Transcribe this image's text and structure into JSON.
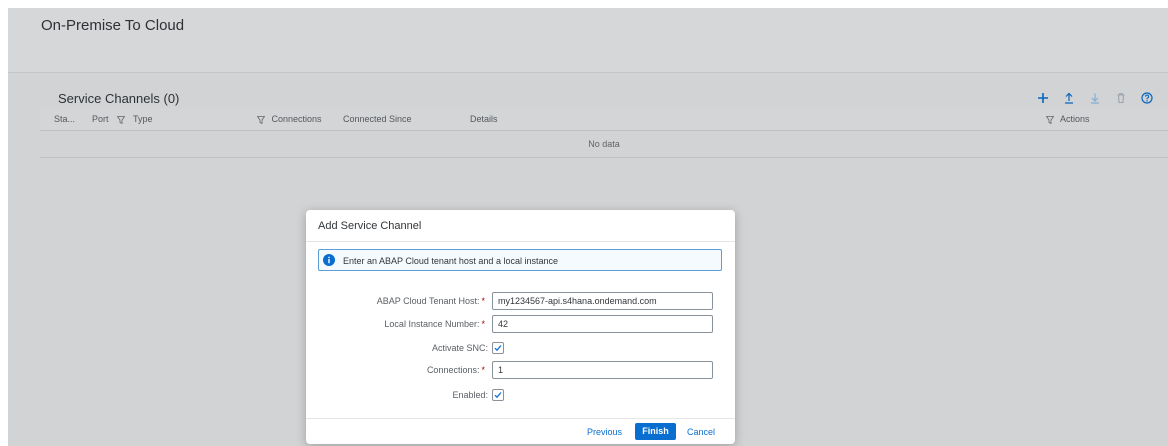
{
  "page": {
    "title": "On-Premise To Cloud"
  },
  "table": {
    "title": "Service Channels (0)",
    "columns": {
      "status": "Sta...",
      "port": "Port",
      "type": "Type",
      "connections": "Connections",
      "connected_since": "Connected Since",
      "details": "Details",
      "actions": "Actions"
    },
    "empty_text": "No data",
    "toolbar_icons": [
      "add-icon",
      "upload-icon",
      "download-icon",
      "delete-icon",
      "help-icon"
    ]
  },
  "dialog": {
    "title": "Add Service Channel",
    "info": "Enter an ABAP Cloud tenant host and a local instance",
    "fields": {
      "host": {
        "label": "ABAP Cloud Tenant Host:",
        "required": "*",
        "value": "my1234567-api.s4hana.ondemand.com"
      },
      "instance": {
        "label": "Local Instance Number:",
        "required": "*",
        "value": "42"
      },
      "snc": {
        "label": "Activate SNC:",
        "checked": true
      },
      "connections": {
        "label": "Connections:",
        "required": "*",
        "value": "1"
      },
      "enabled": {
        "label": "Enabled:",
        "checked": true
      }
    },
    "buttons": {
      "previous": "Previous",
      "finish": "Finish",
      "cancel": "Cancel"
    }
  },
  "colors": {
    "accent": "#0a6ed1",
    "required": "#bb0000",
    "info_border": "#5c9ed8"
  }
}
